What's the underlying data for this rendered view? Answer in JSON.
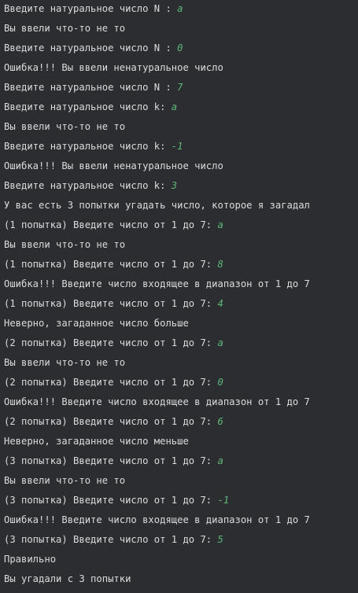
{
  "console": {
    "input_color": "#5fb87a",
    "text_color": "#dcdcdc",
    "background": "#2b2d30",
    "lines": [
      {
        "text": "Введите натуральное число N : ",
        "input": "a"
      },
      {
        "text": "Вы ввели что-то не то",
        "input": ""
      },
      {
        "text": "Введите натуральное число N : ",
        "input": "0"
      },
      {
        "text": "Ошибка!!! Вы ввели ненатуральное число",
        "input": ""
      },
      {
        "text": "Введите натуральное число N : ",
        "input": "7"
      },
      {
        "text": "Введите натуральное число k: ",
        "input": "a"
      },
      {
        "text": "Вы ввели что-то не то",
        "input": ""
      },
      {
        "text": "Введите натуральное число k: ",
        "input": "-1"
      },
      {
        "text": "Ошибка!!! Вы ввели ненатуральное число",
        "input": ""
      },
      {
        "text": "Введите натуральное число k: ",
        "input": "3"
      },
      {
        "text": "У вас есть 3 попытки угадать число, которое я загадал",
        "input": ""
      },
      {
        "text": "(1 попытка) Введите число от 1 до 7: ",
        "input": "a"
      },
      {
        "text": "Вы ввели что-то не то",
        "input": ""
      },
      {
        "text": "(1 попытка) Введите число от 1 до 7: ",
        "input": "8"
      },
      {
        "text": "Ошибка!!! Введите число входящее в диапазон от 1 до 7",
        "input": ""
      },
      {
        "text": "(1 попытка) Введите число от 1 до 7: ",
        "input": "4"
      },
      {
        "text": "Неверно, загаданное число больше",
        "input": ""
      },
      {
        "text": "(2 попытка) Введите число от 1 до 7: ",
        "input": "a"
      },
      {
        "text": "Вы ввели что-то не то",
        "input": ""
      },
      {
        "text": "(2 попытка) Введите число от 1 до 7: ",
        "input": "0"
      },
      {
        "text": "Ошибка!!! Введите число входящее в диапазон от 1 до 7",
        "input": ""
      },
      {
        "text": "(2 попытка) Введите число от 1 до 7: ",
        "input": "6"
      },
      {
        "text": "Неверно, загаданное число меньше",
        "input": ""
      },
      {
        "text": "(3 попытка) Введите число от 1 до 7: ",
        "input": "a"
      },
      {
        "text": "Вы ввели что-то не то",
        "input": ""
      },
      {
        "text": "(3 попытка) Введите число от 1 до 7: ",
        "input": "-1"
      },
      {
        "text": "Ошибка!!! Введите число входящее в диапазон от 1 до 7",
        "input": ""
      },
      {
        "text": "(3 попытка) Введите число от 1 до 7: ",
        "input": "5"
      },
      {
        "text": "Правильно",
        "input": ""
      },
      {
        "text": "Вы угадали с 3 попытки",
        "input": ""
      }
    ]
  }
}
